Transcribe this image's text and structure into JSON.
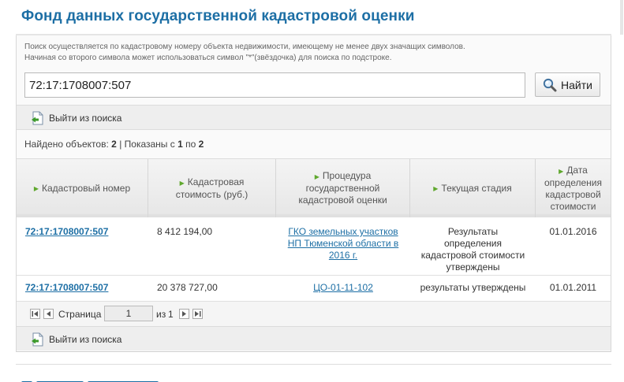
{
  "page": {
    "title": "Фонд данных государственной кадастровой оценки"
  },
  "search": {
    "hint_line1": "Поиск осуществляется по кадастровому номеру объекта недвижимости, имеющему не менее двух значащих символов.",
    "hint_line2": "Начиная со второго символа может использоваться символ \"*\"(звёздочка) для поиска по подстроке.",
    "value": "72:17:1708007:507",
    "button_label": "Найти",
    "icon": "magnifier-icon"
  },
  "exit_link": {
    "label": "Выйти из поиска",
    "icon": "exit-document-icon"
  },
  "results_summary": {
    "found_label": "Найдено объектов:",
    "found_count": "2",
    "separator": "|",
    "shown_label": "Показаны с",
    "from": "1",
    "to_label": "по",
    "to": "2"
  },
  "table": {
    "columns": [
      "Кадастровый номер",
      "Кадастровая стоимость (руб.)",
      "Процедура государственной кадастровой оценки",
      "Текущая стадия",
      "Дата определения кадастровой стоимости"
    ],
    "rows": [
      {
        "cadastral_number": "72:17:1708007:507",
        "value": "8 412 194,00",
        "procedure": "ГКО земельных участков НП Тюменской области в 2016 г.",
        "stage": "Результаты определения кадастровой стоимости утверждены",
        "date": "01.01.2016"
      },
      {
        "cadastral_number": "72:17:1708007:507",
        "value": "20 378 727,00",
        "procedure": "ЦО-01-11-102",
        "stage": "результаты утверждены",
        "date": "01.01.2011"
      }
    ]
  },
  "pager": {
    "page_label": "Страница",
    "page_value": "1",
    "of_label": "из",
    "total_pages": "1"
  },
  "colors": {
    "title_blue": "#1d6fa5",
    "arrow_green": "#5fa82d"
  }
}
